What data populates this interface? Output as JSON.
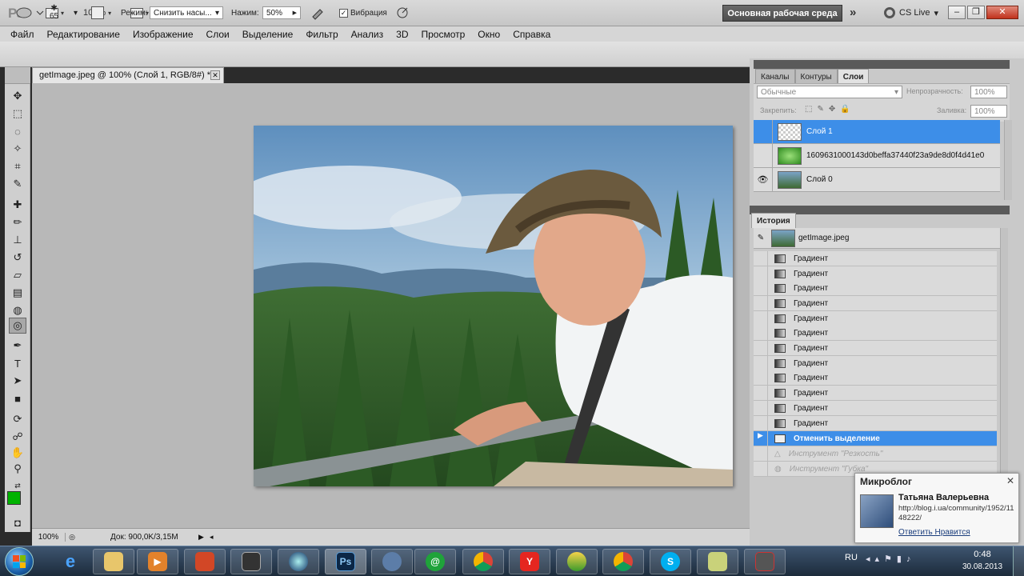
{
  "app": {
    "logo": "Ps",
    "zoom": "100%",
    "workspace": "Основная рабочая среда",
    "more": "»",
    "cs_live": "CS Live",
    "caret": "▾"
  },
  "window_controls": {
    "minimize": "‒",
    "maximize": "❐",
    "close": "✕"
  },
  "menu": [
    "Файл",
    "Редактирование",
    "Изображение",
    "Слои",
    "Выделение",
    "Фильтр",
    "Анализ",
    "3D",
    "Просмотр",
    "Окно",
    "Справка"
  ],
  "options": {
    "brush_size": "65",
    "mode_label": "Режим:",
    "mode_value": "Снизить насы...",
    "pressure_label": "Нажим:",
    "pressure_value": "50%",
    "vibrance_label": "Вибрация"
  },
  "document": {
    "tab_title": "getImage.jpeg @ 100% (Слой 1, RGB/8#) *",
    "close": "✕"
  },
  "status": {
    "zoom": "100%",
    "doc_info": "Док: 900,0K/3,15M",
    "play": "▶",
    "scroll_left": "◂"
  },
  "layers_panel": {
    "tabs": [
      "Каналы",
      "Контуры",
      "Слои"
    ],
    "blend_mode": "Обычные",
    "opacity_label": "Непрозрачность:",
    "opacity_value": "100%",
    "lock_label": "Закрепить:",
    "fill_label": "Заливка:",
    "fill_value": "100%",
    "layers": [
      {
        "name": "Слой 1",
        "visible": false,
        "selected": true
      },
      {
        "name": "1609631000143d0beffa37440f23a9de8d0f4d41e0",
        "visible": false,
        "selected": false
      },
      {
        "name": "Слой 0",
        "visible": true,
        "selected": false
      }
    ]
  },
  "history_panel": {
    "tab": "История",
    "snapshot": "getImage.jpeg",
    "items": [
      "Градиент",
      "Градиент",
      "Градиент",
      "Градиент",
      "Градиент",
      "Градиент",
      "Градиент",
      "Градиент",
      "Градиент",
      "Градиент",
      "Градиент",
      "Градиент",
      "Отменить выделение",
      "Инструмент \"Резкость\"",
      "Инструмент \"Губка\""
    ],
    "selected_index": 12
  },
  "popup": {
    "title": "Микроблог",
    "name": "Татьяна Валерьевна",
    "link": "http://blog.i.ua/community/1952/1148222/",
    "action": "Ответить  Нравится",
    "close": "✕"
  },
  "tray": {
    "lang": "RU",
    "time": "0:48",
    "date": "30.08.2013"
  },
  "taskbar_apps": [
    "explorer",
    "media",
    "office",
    "terminal",
    "globe",
    "photoshop",
    "network",
    "mail",
    "chrome",
    "yandex",
    "game",
    "chrome2",
    "skype",
    "notes",
    "audio"
  ],
  "taskbar_labels": {
    "photoshop": "Ps",
    "skype": "S",
    "mail": "@"
  },
  "colors": {
    "accent": "#3d8ee8",
    "foreground": "#00b300",
    "background": "#ffffff"
  }
}
